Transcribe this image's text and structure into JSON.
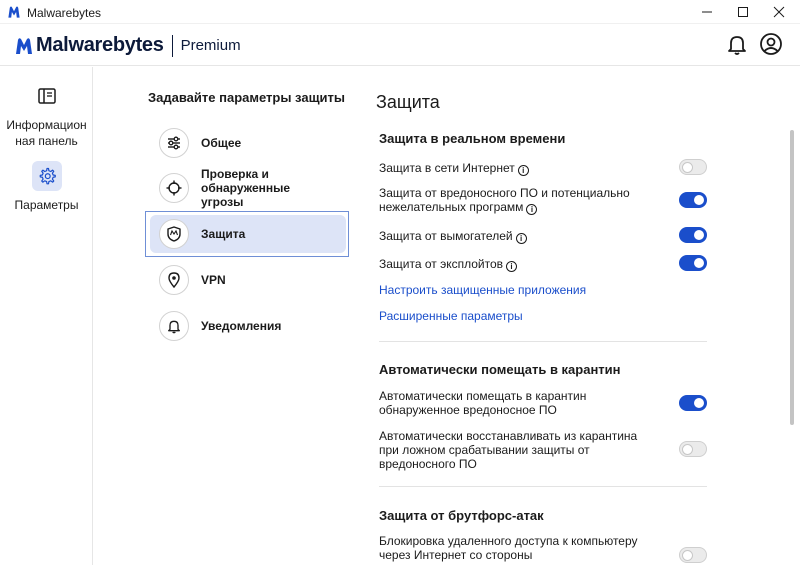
{
  "window": {
    "title": "Malwarebytes"
  },
  "header": {
    "brand": "Malwarebytes",
    "edition": "Premium"
  },
  "nav": {
    "items": [
      {
        "label": "Информацион ная панель",
        "icon": "dashboard-icon"
      },
      {
        "label": "Параметры",
        "icon": "gear-icon",
        "active": true
      }
    ]
  },
  "categories": {
    "title": "Задавайте параметры защиты",
    "items": [
      {
        "label": "Общее",
        "icon": "sliders-icon"
      },
      {
        "label": "Проверка и обнаруженные угрозы",
        "icon": "crosshair-icon"
      },
      {
        "label": "Защита",
        "icon": "shield-icon",
        "active": true
      },
      {
        "label": "VPN",
        "icon": "location-pin-icon"
      },
      {
        "label": "Уведомления",
        "icon": "bell-icon"
      }
    ]
  },
  "panel": {
    "title": "Защита",
    "realtime": {
      "title": "Защита в реальном времени",
      "rows": [
        {
          "label": "Защита в сети Интернет",
          "info": true,
          "enabled": false
        },
        {
          "label": "Защита от вредоносного ПО и потенциально нежелательных программ",
          "info": true,
          "enabled": true
        },
        {
          "label": "Защита от вымогателей",
          "info": true,
          "enabled": true
        },
        {
          "label": "Защита от эксплойтов",
          "info": true,
          "enabled": true
        }
      ],
      "link_apps": "Настроить защищенные приложения",
      "link_advanced": "Расширенные параметры"
    },
    "quarantine": {
      "title": "Автоматически помещать в карантин",
      "rows": [
        {
          "label": "Автоматически помещать в карантин обнаруженное вредоносное ПО",
          "enabled": true
        },
        {
          "label": "Автоматически восстанавливать из карантина при ложном срабатывании защиты от вредоносного ПО",
          "enabled": false
        }
      ]
    },
    "bruteforce": {
      "title": "Защита от брутфорс-атак",
      "rows": [
        {
          "label": "Блокировка удаленного доступа к компьютеру через Интернет со стороны неавторизованных",
          "enabled": false
        }
      ]
    }
  },
  "colors": {
    "accent": "#1a4ecb",
    "active_bg": "#dde4f7",
    "brand_dark": "#0d1a3a"
  }
}
